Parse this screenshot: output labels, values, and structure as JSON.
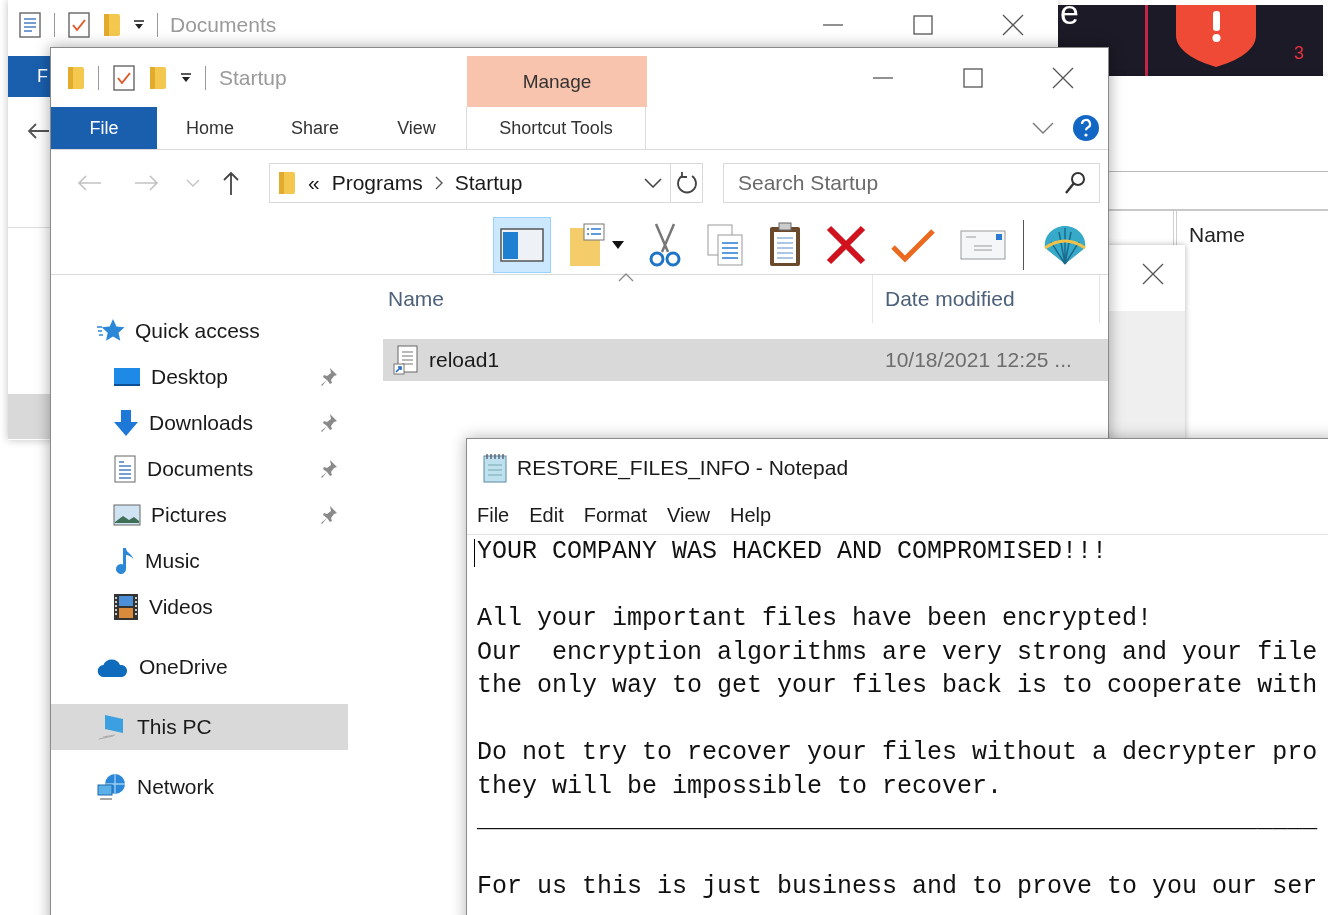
{
  "background_explorer": {
    "title": "Documents",
    "file_tab": "F"
  },
  "security_app": {
    "logo_text": "e",
    "count": "3"
  },
  "right_window": {
    "column_header": "Name"
  },
  "explorer": {
    "title": "Startup",
    "context_header": "Manage",
    "ribbon_tabs": [
      {
        "label": "File",
        "kind": "file"
      },
      {
        "label": "Home",
        "kind": "tab"
      },
      {
        "label": "Share",
        "kind": "tab"
      },
      {
        "label": "View",
        "kind": "tab"
      },
      {
        "label": "Shortcut Tools",
        "kind": "context"
      }
    ],
    "address": {
      "overflow": "«",
      "crumbs": [
        "Programs",
        "Startup"
      ]
    },
    "search": {
      "placeholder": "Search Startup"
    },
    "toolbar": [
      {
        "kind": "preview-pane",
        "selected": true
      },
      {
        "kind": "properties",
        "selected": false
      },
      {
        "kind": "cut",
        "selected": false
      },
      {
        "kind": "copy",
        "selected": false
      },
      {
        "kind": "paste",
        "selected": false
      },
      {
        "kind": "delete",
        "selected": false
      },
      {
        "kind": "check",
        "selected": false
      },
      {
        "kind": "email",
        "selected": false
      },
      {
        "kind": "shell",
        "selected": false
      }
    ],
    "nav": [
      {
        "label": "Quick access",
        "kind": "quick",
        "selected": false,
        "children": [
          {
            "label": "Desktop",
            "kind": "desktop",
            "pinned": true,
            "selected": false
          },
          {
            "label": "Downloads",
            "kind": "downloads",
            "pinned": true,
            "selected": false
          },
          {
            "label": "Documents",
            "kind": "documents",
            "pinned": true,
            "selected": false
          },
          {
            "label": "Pictures",
            "kind": "pictures",
            "pinned": true,
            "selected": false
          },
          {
            "label": "Music",
            "kind": "music",
            "pinned": false,
            "selected": false
          },
          {
            "label": "Videos",
            "kind": "videos",
            "pinned": false,
            "selected": false
          }
        ]
      },
      {
        "label": "OneDrive",
        "kind": "onedrive",
        "selected": false
      },
      {
        "label": "This PC",
        "kind": "pc",
        "selected": true
      },
      {
        "label": "Network",
        "kind": "network",
        "selected": false
      }
    ],
    "columns": [
      {
        "label": "Name",
        "sorted": true
      },
      {
        "label": "Date modified",
        "sorted": false
      }
    ],
    "files": [
      {
        "name": "reload1",
        "date": "10/18/2021 12:25 ...",
        "selected": true
      }
    ]
  },
  "notepad": {
    "title": "RESTORE_FILES_INFO - Notepad",
    "menu": [
      "File",
      "Edit",
      "Format",
      "View",
      "Help"
    ],
    "paragraphs": [
      [
        "YOUR COMPANY WAS HACKED AND COMPROMISED!!!"
      ],
      [
        "All your important files have been encrypted!",
        "Our  encryption algorithms are very strong and your file",
        "the only way to get your files back is to cooperate with"
      ],
      [
        "Do not try to recover your files without a decrypter pro",
        "they will be impossible to recover.",
        "________________________________________________________"
      ],
      [
        "For us this is just business and to prove to you our ser"
      ]
    ]
  }
}
